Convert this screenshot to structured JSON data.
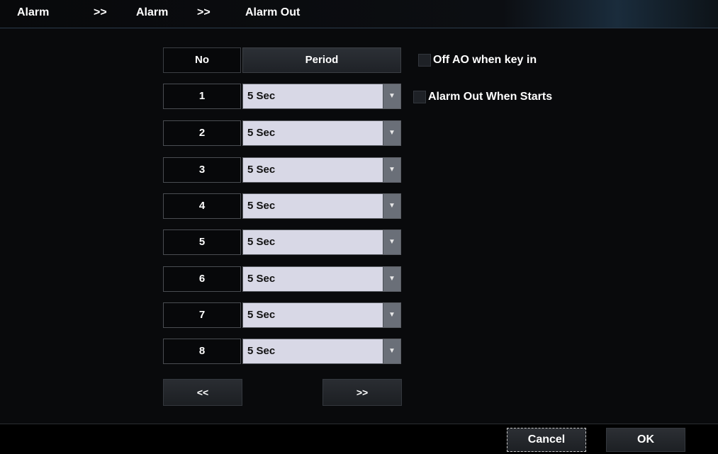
{
  "breadcrumb": {
    "level1": "Alarm",
    "sep1": ">>",
    "level2": "Alarm",
    "sep2": ">>",
    "level3": "Alarm Out"
  },
  "table": {
    "headers": {
      "no": "No",
      "period": "Period"
    },
    "rows": [
      {
        "no": "1",
        "period": "5 Sec"
      },
      {
        "no": "2",
        "period": "5 Sec"
      },
      {
        "no": "3",
        "period": "5 Sec"
      },
      {
        "no": "4",
        "period": "5 Sec"
      },
      {
        "no": "5",
        "period": "5 Sec"
      },
      {
        "no": "6",
        "period": "5 Sec"
      },
      {
        "no": "7",
        "period": "5 Sec"
      },
      {
        "no": "8",
        "period": "5 Sec"
      }
    ]
  },
  "options": {
    "off_ao_label": "Off AO when key in",
    "off_ao_checked": false,
    "alarm_out_starts_label": "Alarm Out When Starts",
    "alarm_out_starts_checked": false
  },
  "pager": {
    "prev_label": "<<",
    "next_label": ">>"
  },
  "footer": {
    "cancel_label": "Cancel",
    "ok_label": "OK"
  },
  "icons": {
    "dropdown": "chevron-down-icon"
  }
}
